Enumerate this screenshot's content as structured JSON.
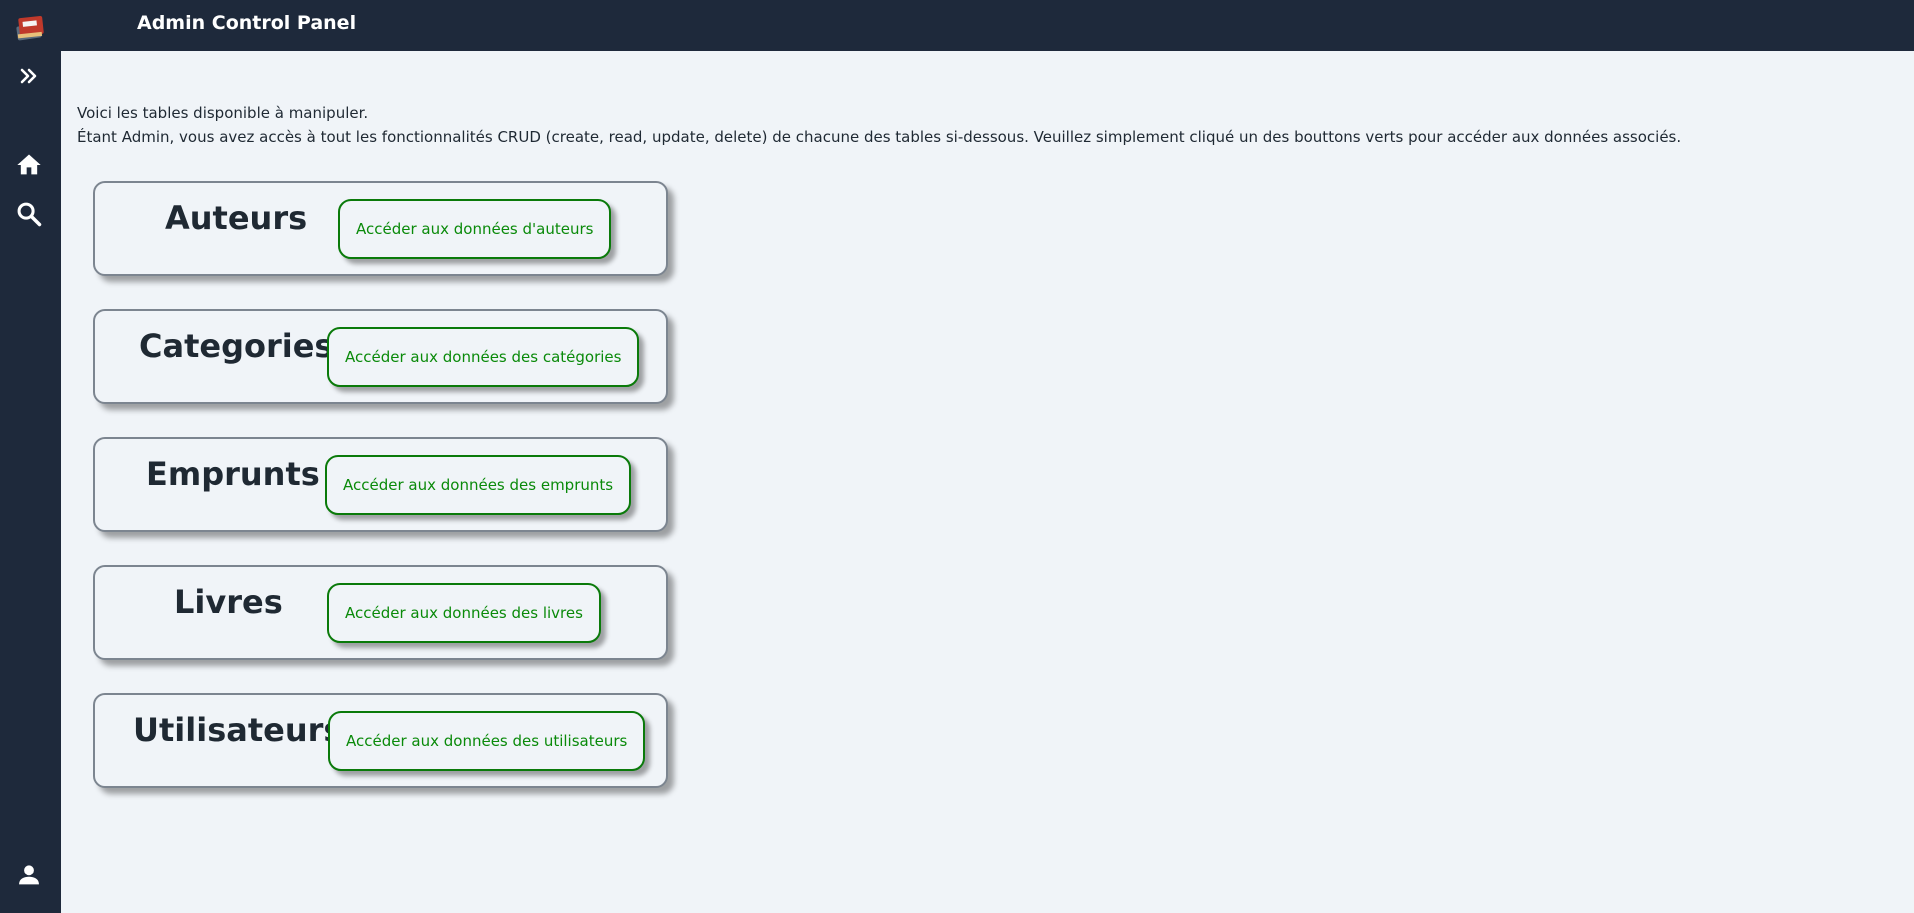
{
  "header": {
    "title": "Admin Control Panel"
  },
  "sidebar": {
    "logo_icon": "book-stack-icon",
    "items": [
      {
        "icon": "double-chevron-right-icon"
      },
      {
        "icon": "home-icon"
      },
      {
        "icon": "search-icon"
      },
      {
        "icon": "user-icon"
      }
    ]
  },
  "intro": {
    "line1": "Voici les tables disponible à manipuler.",
    "line2": "Étant Admin, vous avez accès à tout les fonctionnalités CRUD (create, read, update, delete) de chacune des tables si-dessous. Veuillez simplement cliqué un des bouttons verts pour accéder aux données associés."
  },
  "cards": [
    {
      "title": "Auteurs",
      "button": "Accéder aux données d'auteurs"
    },
    {
      "title": "Categories",
      "button": "Accéder aux données des catégories"
    },
    {
      "title": "Emprunts",
      "button": "Accéder aux données des emprunts"
    },
    {
      "title": "Livres",
      "button": "Accéder aux données des livres"
    },
    {
      "title": "Utilisateurs",
      "button": "Accéder aux données des utilisateurs"
    }
  ],
  "colors": {
    "topbar": "#1e293b",
    "background": "#f0f4f8",
    "button_green": "#0a7a0a"
  }
}
